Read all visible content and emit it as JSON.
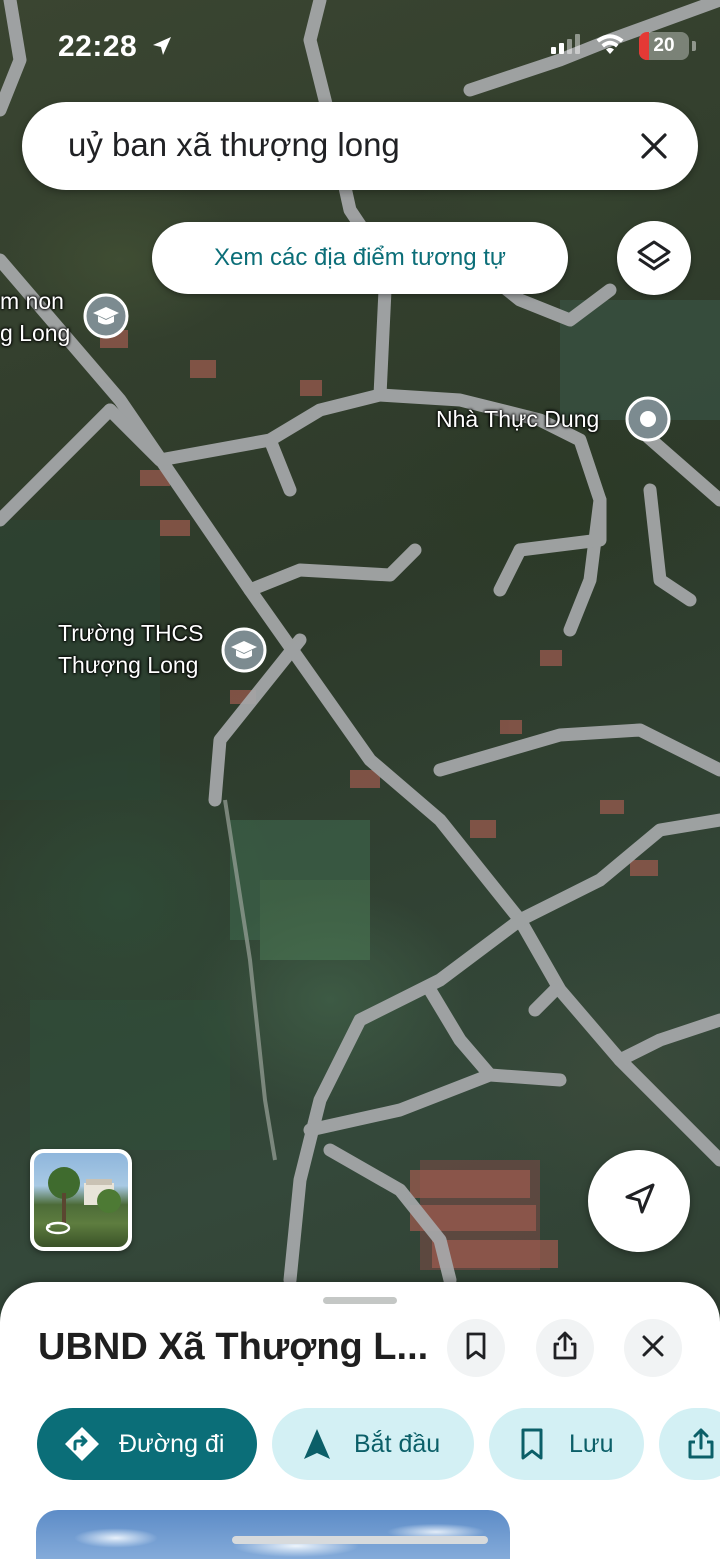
{
  "status_bar": {
    "time": "22:28",
    "battery_level": "20",
    "battery_color": "#e53935",
    "icons": [
      "location-arrow-icon",
      "cellular-signal-icon",
      "wifi-icon",
      "battery-icon"
    ]
  },
  "search": {
    "query": "uỷ ban xã thượng long",
    "clear_icon": "close-icon"
  },
  "map": {
    "similar_places_button": "Xem các địa điểm tương tự",
    "layers_icon": "layers-icon",
    "labels": {
      "kindergarten_line1": "m non",
      "kindergarten_line2": "g Long",
      "house": "Nhà Thực Dung",
      "school_line1": "Trường THCS",
      "school_line2": "Thượng Long"
    },
    "street_view_icon": "rotate-360-icon",
    "locate_icon": "navigation-arrow-icon"
  },
  "place_sheet": {
    "title": "UBND Xã Thượng L...",
    "header_icons": [
      "bookmark-icon",
      "share-icon",
      "close-icon"
    ],
    "actions": {
      "directions": "Đường đi",
      "start": "Bắt đầu",
      "save": "Lưu"
    }
  },
  "colors": {
    "accent": "#0b6e78",
    "chip_light": "#d3f0f4",
    "road": "#a7a9ab"
  }
}
